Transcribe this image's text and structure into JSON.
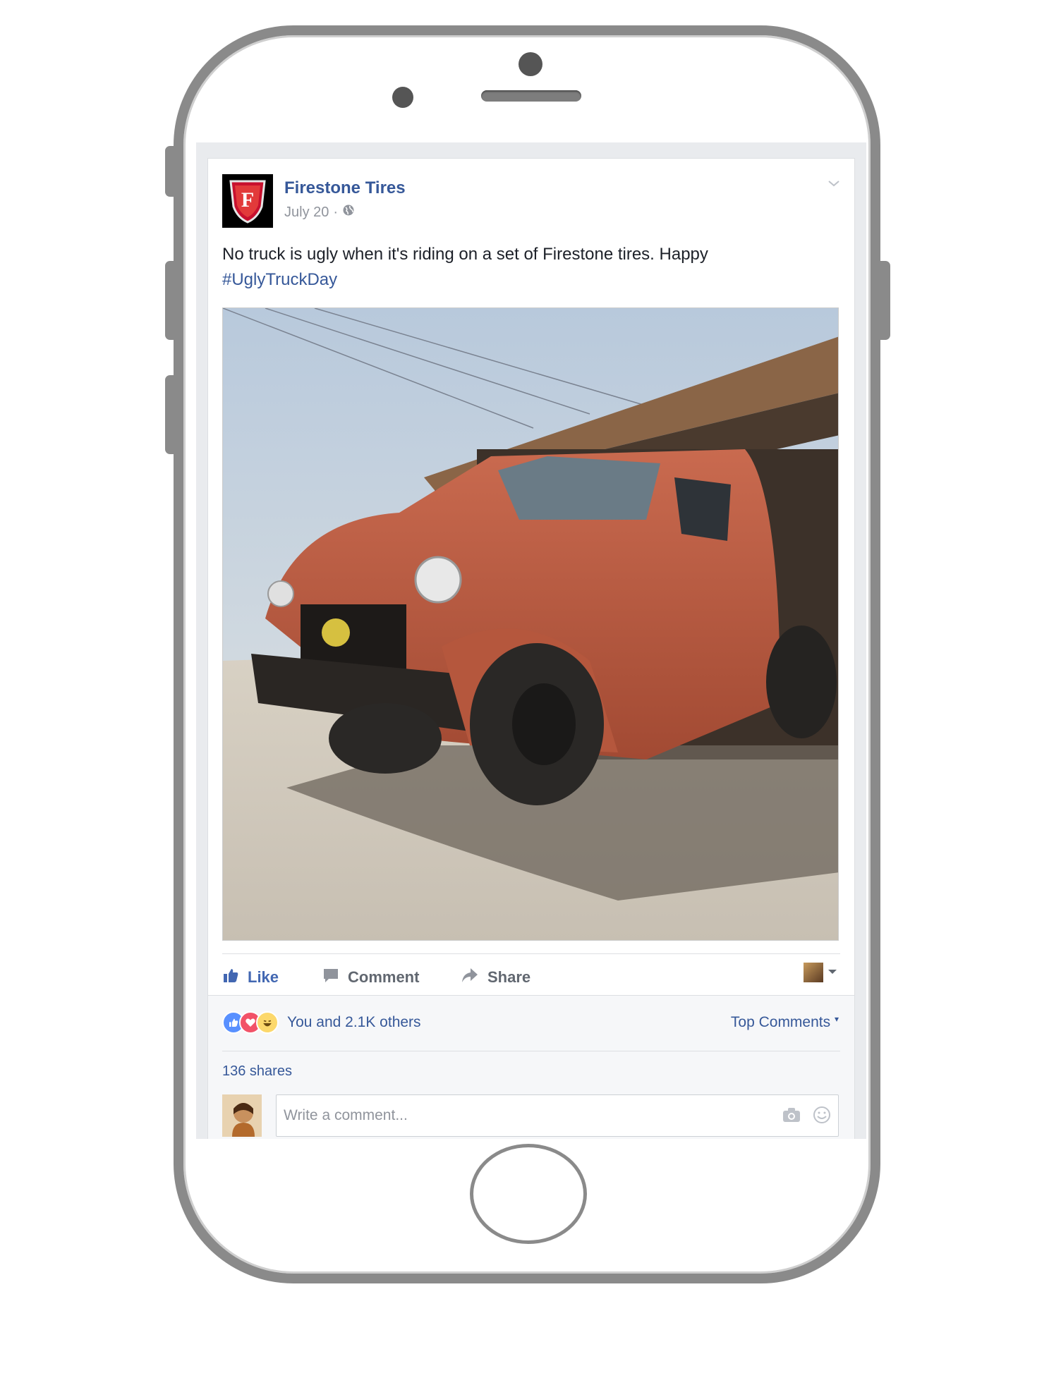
{
  "post": {
    "page_name": "Firestone Tires",
    "date": "July 20",
    "date_separator": "·",
    "text": "No truck is ugly when it's riding on a set of Firestone tires. Happy",
    "hashtag": "#UglyTruckDay"
  },
  "actions": {
    "like": "Like",
    "comment": "Comment",
    "share": "Share"
  },
  "engagement": {
    "reactions_text": "You and 2.1K others",
    "top_comments": "Top Comments",
    "shares": "136 shares"
  },
  "comment_input": {
    "placeholder": "Write a comment..."
  },
  "colors": {
    "link_blue": "#365899",
    "like_blue": "#4267b2",
    "phone_frame": "#8a8a8a",
    "truck_red": "#b8583e"
  },
  "icons": [
    "firestone-logo",
    "globe-icon",
    "chevron-down-icon",
    "like-icon",
    "comment-icon",
    "share-icon",
    "like-reaction-icon",
    "love-reaction-icon",
    "haha-reaction-icon",
    "camera-icon",
    "emoji-icon"
  ]
}
